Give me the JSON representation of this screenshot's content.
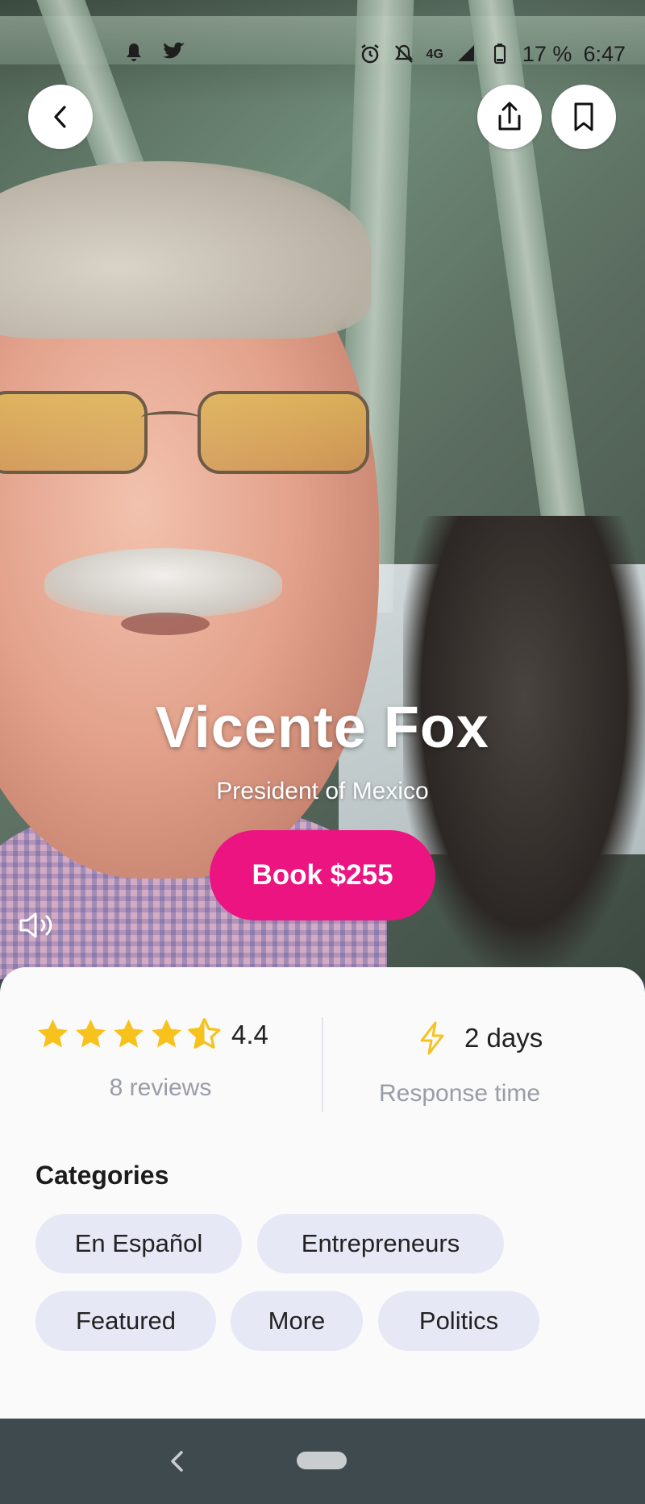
{
  "status_bar": {
    "network": "4G",
    "battery": "17 %",
    "time": "6:47",
    "icons": [
      "notification-bell-icon",
      "twitter-icon",
      "alarm-icon",
      "mute-icon",
      "signal-icon",
      "battery-icon"
    ]
  },
  "header": {
    "back_icon": "chevron-left-icon",
    "share_icon": "share-icon",
    "bookmark_icon": "bookmark-icon"
  },
  "profile": {
    "name": "Vicente Fox",
    "title": "President of Mexico",
    "book_label": "Book $255",
    "book_color": "#ec1480",
    "sound_icon": "speaker-icon"
  },
  "stats": {
    "rating": "4.4",
    "rating_fraction": 0.88,
    "star_color": "#f7c21b",
    "reviews": "8 reviews",
    "response_value": "2 days",
    "response_label": "Response time"
  },
  "categories": {
    "title": "Categories",
    "items": [
      "En Español",
      "Entrepreneurs",
      "Featured",
      "More",
      "Politics"
    ]
  },
  "nav": {
    "back_icon": "nav-back-icon",
    "home_icon": "home-pill-icon"
  }
}
